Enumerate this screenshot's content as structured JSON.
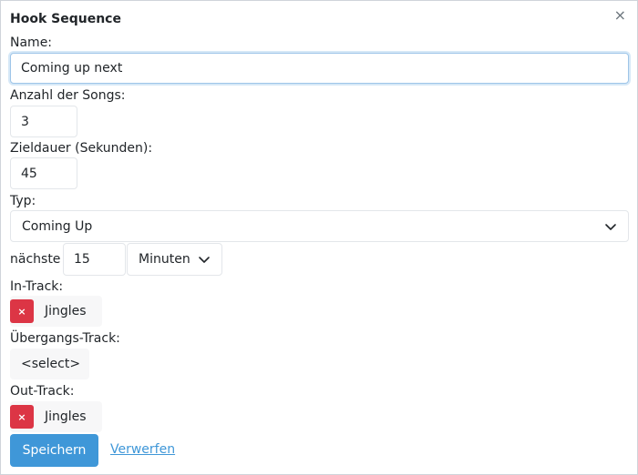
{
  "dialog": {
    "title": "Hook Sequence",
    "close_glyph": "×"
  },
  "fields": {
    "name_label": "Name:",
    "name_value": "Coming up next",
    "count_label": "Anzahl der Songs:",
    "count_value": "3",
    "duration_label": "Zieldauer (Sekunden):",
    "duration_value": "45",
    "type_label": "Typ:",
    "type_value": "Coming Up",
    "next_label": "nächste",
    "next_value": "15",
    "unit_value": "Minuten",
    "in_track_label": "In-Track:",
    "in_track_value": "Jingles",
    "transition_label": "Übergangs-Track:",
    "transition_value": "<select>",
    "out_track_label": "Out-Track:",
    "out_track_value": "Jingles",
    "remove_glyph": "×"
  },
  "actions": {
    "save_label": "Speichern",
    "discard_label": "Verwerfen"
  },
  "icons": {
    "close": "close-icon",
    "chevron": "chevron-down-icon",
    "remove": "remove-icon"
  },
  "colors": {
    "primary": "#3f97d8",
    "danger": "#dc3545",
    "focus_border": "#9ec5e8"
  }
}
